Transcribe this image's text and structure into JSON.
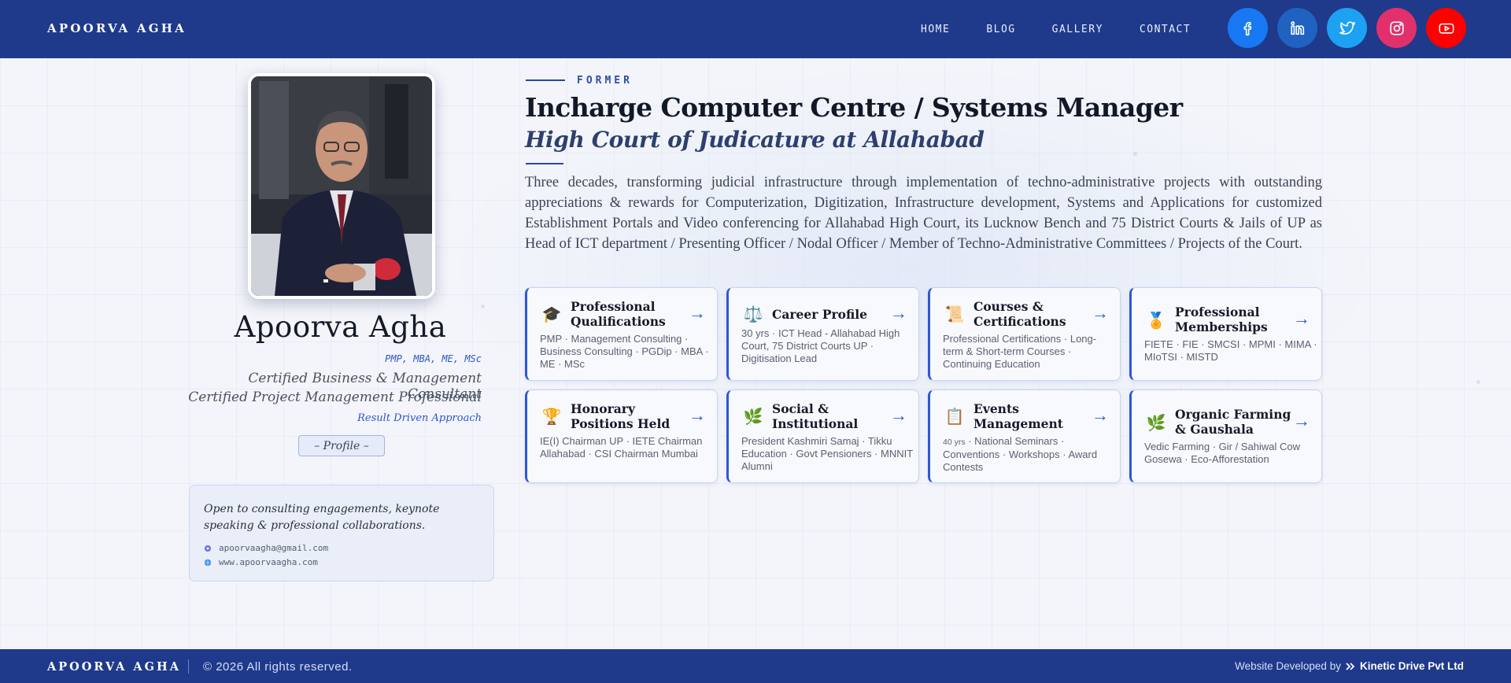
{
  "header": {
    "brand": "APOORVA AGHA",
    "nav": [
      "HOME",
      "BLOG",
      "GALLERY",
      "CONTACT"
    ],
    "socials": [
      {
        "icon": "facebook-icon",
        "color": "#1877f2"
      },
      {
        "icon": "linkedin-icon",
        "color": "#1f62c2"
      },
      {
        "icon": "twitter-icon",
        "color": "#1da1f2"
      },
      {
        "icon": "instagram-icon",
        "color": "#e1306c"
      },
      {
        "icon": "youtube-icon",
        "color": "#ff0000"
      }
    ]
  },
  "profile": {
    "name": "Apoorva Agha",
    "credentials": "PMP, MBA, ME, MSc",
    "cert_1": "Certified Business & Management Consultant",
    "cert_2": "Certified Project Management Professional",
    "approach": "Result Driven Approach",
    "profile_button": "– Profile –"
  },
  "contact": {
    "text": "Open to consulting engagements, keynote speaking & professional collaborations.",
    "email": "apoorvaagha@gmail.com",
    "website": "www.apoorvaagha.com"
  },
  "hero": {
    "eyebrow": "FORMER",
    "title": "Incharge Computer Centre / Systems Manager",
    "subtitle": "High Court of Judicature at Allahabad",
    "summary": "Three decades, transforming judicial infrastructure through implementation of techno-administrative projects with outstanding appreciations & rewards for Computerization, Digitization, Infrastructure development, Systems and Applications for customized Establishment Portals and Video conferencing for Allahabad High Court, its Lucknow Bench and 75 District Courts & Jails of UP as Head of ICT department / Presenting Officer / Nodal Officer / Member of Techno-Administrative Committees / Projects of the Court."
  },
  "cards": [
    {
      "icon": "graduation-cap-icon",
      "glyph": "🎓",
      "title": "Professional Qualifications",
      "desc": "PMP · Management Consulting · Business Consulting · PGDip · MBA · ME · MSc"
    },
    {
      "icon": "scales-icon",
      "glyph": "⚖️",
      "title": "Career Profile",
      "desc_small": "30 yrs",
      "desc": " · ICT Head - Allahabad High Court, 75 District Courts UP · Digitisation Lead"
    },
    {
      "icon": "scroll-icon",
      "glyph": "📜",
      "title": "Courses & Certifications",
      "desc": "Professional Certifications · Long-term & Short-term Courses · Continuing Education"
    },
    {
      "icon": "medal-icon",
      "glyph": "🏅",
      "title": "Professional Memberships",
      "desc": "FIETE · FIE · SMCSI · MPMI · MIMA · MIoTSI · MISTD"
    },
    {
      "icon": "trophy-icon",
      "glyph": "🏆",
      "title": "Honorary Positions Held",
      "desc": "IE(I) Chairman UP · IETE Chairman Allahabad · CSI Chairman Mumbai"
    },
    {
      "icon": "leaf-icon",
      "glyph": "🌿",
      "title": "Social & Institutional",
      "desc": "President Kashmiri Samaj · Tikku Education · Govt Pensioners · MNNIT Alumni"
    },
    {
      "icon": "clipboard-icon",
      "glyph": "📋",
      "title": "Events Management",
      "desc_small": "40 yrs",
      "desc": " · National Seminars · Conventions · Workshops · Award Contests"
    },
    {
      "icon": "seedling-icon",
      "glyph": "🌿",
      "title": "Organic Farming & Gaushala",
      "desc": "Vedic Farming · Gir / Sahiwal Cow Gosewa · Eco-Afforestation"
    }
  ],
  "card_arrow": "→",
  "footer": {
    "brand": "APOORVA AGHA",
    "copyright": "© 2026 All rights reserved.",
    "developed_by": "Website Developed by",
    "developer": "Kinetic Drive Pvt Ltd"
  }
}
